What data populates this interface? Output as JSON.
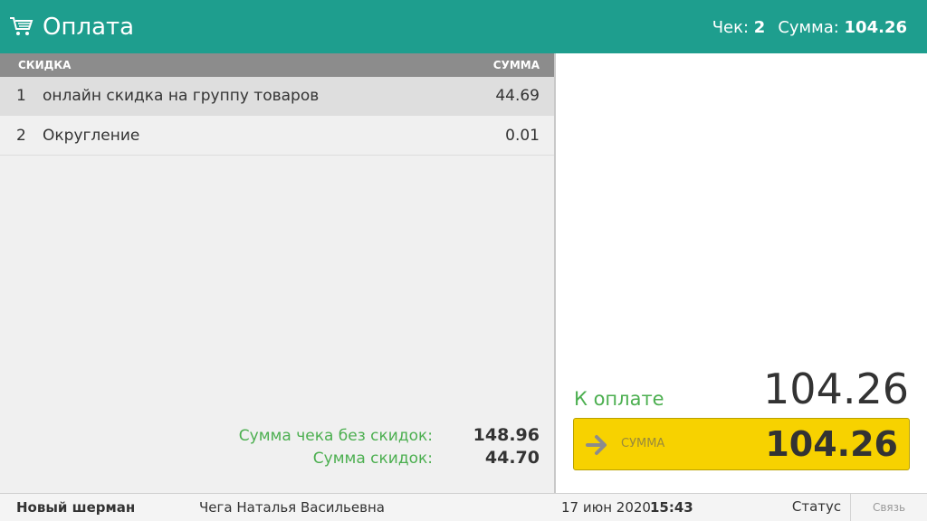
{
  "header": {
    "title": "Оплата",
    "receipt_label": "Чек:",
    "receipt_number": "2",
    "sum_label": "Сумма:",
    "sum_value": "104.26",
    "color": "#1e9e8e"
  },
  "table": {
    "columns": {
      "discount": "СКИДКА",
      "sum": "СУММА"
    },
    "rows": [
      {
        "num": "1",
        "name": "онлайн скидка на группу товаров",
        "amount": "44.69"
      },
      {
        "num": "2",
        "name": "Округление",
        "amount": "0.01"
      }
    ]
  },
  "totals": {
    "no_discount_label": "Сумма чека без скидок:",
    "no_discount_value": "148.96",
    "discount_label": "Сумма скидок:",
    "discount_value": "44.70"
  },
  "payment": {
    "to_pay_label": "К оплате",
    "to_pay_value": "104.26",
    "button_label": "СУММА",
    "button_value": "104.26",
    "button_color": "#f7d200"
  },
  "footer": {
    "store": "Новый шерман",
    "cashier": "Чега Наталья Васильевна",
    "date": "17 июн 2020",
    "time": "15:43",
    "status": "Статус",
    "link": "Связь"
  }
}
